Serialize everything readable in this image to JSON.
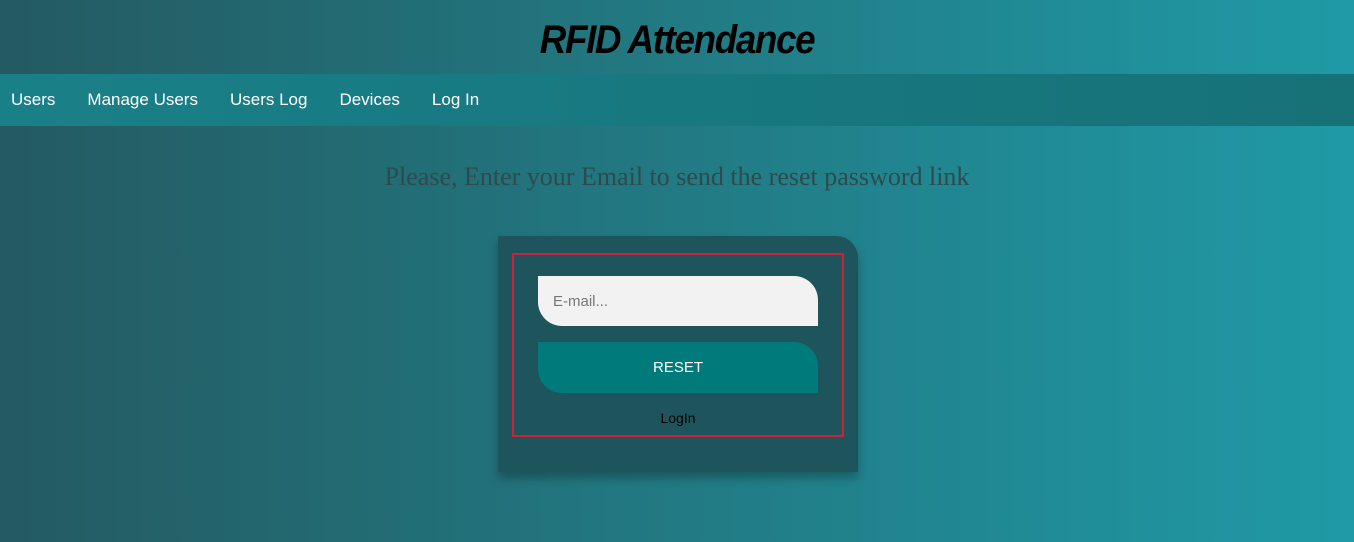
{
  "header": {
    "title": "RFID Attendance"
  },
  "nav": {
    "items": [
      {
        "label": "Users"
      },
      {
        "label": "Manage Users"
      },
      {
        "label": "Users Log"
      },
      {
        "label": "Devices"
      },
      {
        "label": "Log In"
      }
    ]
  },
  "main": {
    "prompt": "Please, Enter your Email to send the reset password link"
  },
  "reset_form": {
    "email_value": "",
    "email_placeholder": "E-mail...",
    "reset_label": "RESET",
    "login_label": "LogIn"
  },
  "colors": {
    "card_bg": "#1e555d",
    "button_bg": "#007a7a",
    "highlight_border": "#d0213a"
  }
}
